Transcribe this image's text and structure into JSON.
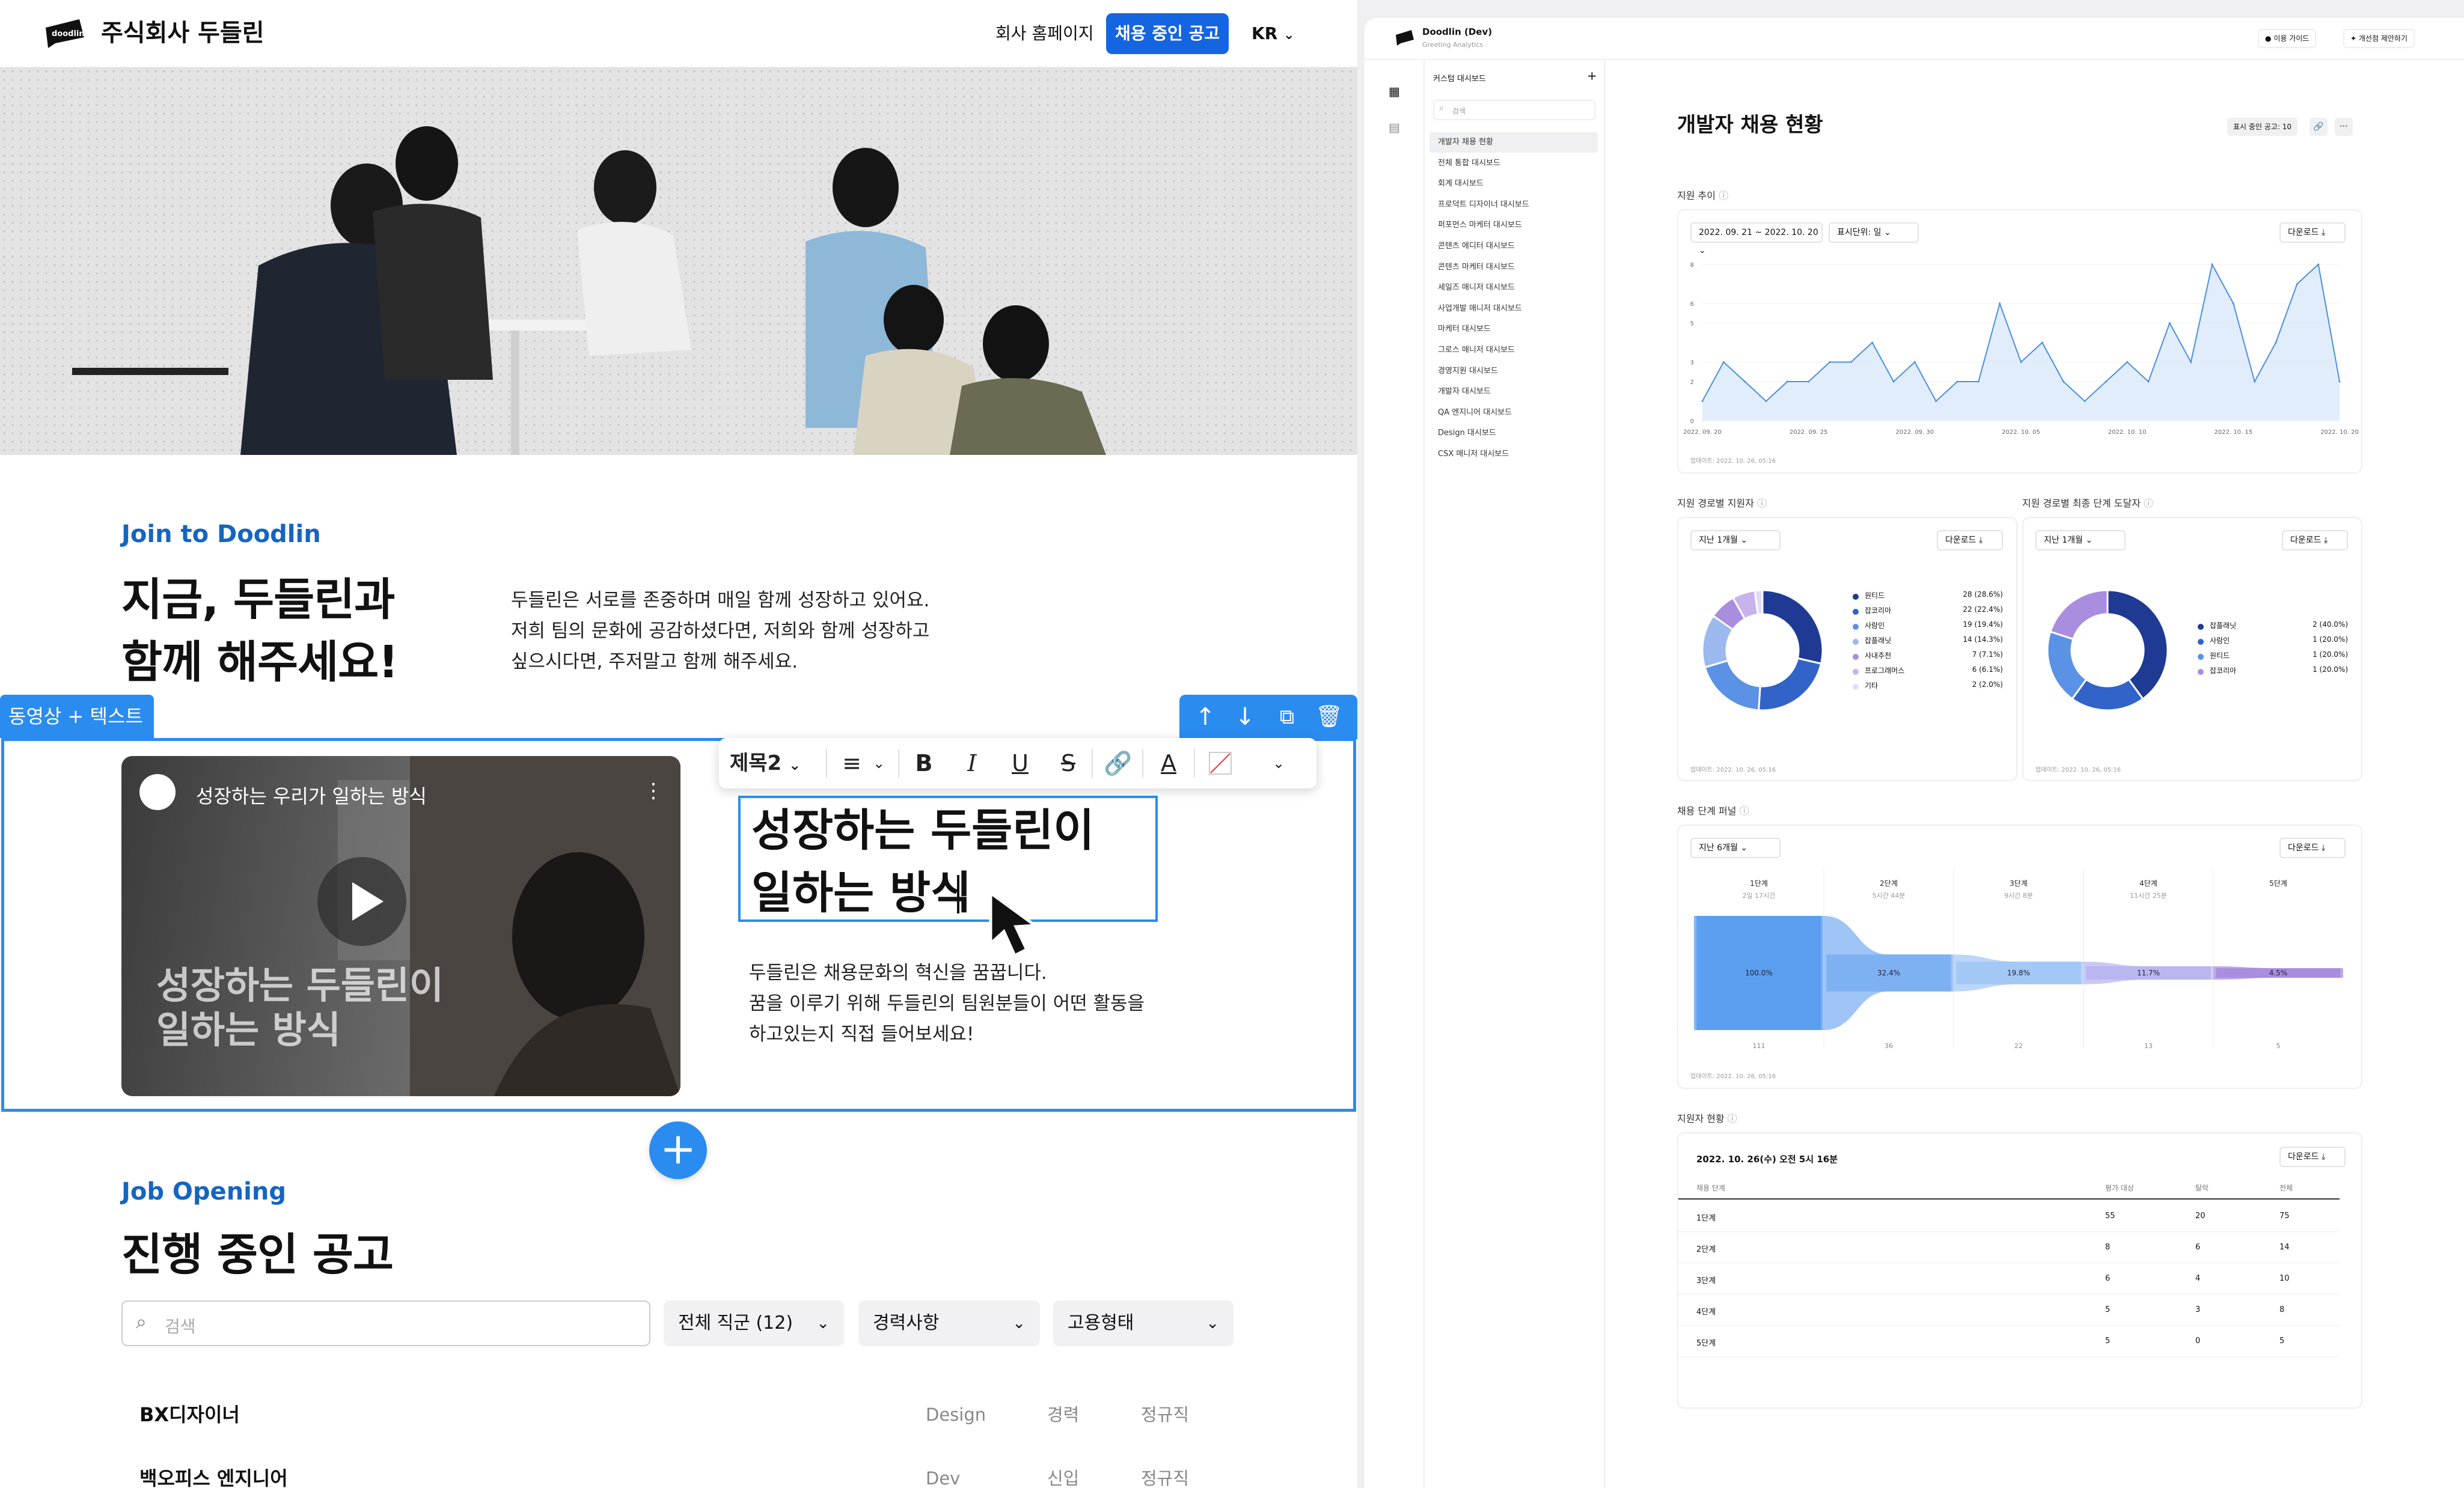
{
  "left": {
    "header": {
      "company": "주식회사 두들린",
      "logo_text": "doodlin",
      "nav_home": "회사 홈페이지",
      "nav_jobs": "채용 중인 공고",
      "lang": "KR"
    },
    "intro": {
      "eyebrow": "Join to Doodlin",
      "headline_1": "지금, 두들린과",
      "headline_2": "함께 해주세요!",
      "body_1": "두들린은 서로를 존중하며 매일 함께 성장하고 있어요.",
      "body_2": "저희 팀의 문화에 공감하셨다면, 저희와 함께 성장하고",
      "body_3": "싶으시다면, 주저말고 함께 해주세요."
    },
    "editor": {
      "block_tag": "동영상 + 텍스트",
      "video_title": "성장하는 우리가 일하는 방식",
      "video_overlay_1": "성장하는 두들린이",
      "video_overlay_2": "일하는 방식",
      "format_style": "제목2",
      "heading_1": "성장하는 두들린이",
      "heading_2": "일하는 방식",
      "body_1": "두들린은 채용문화의 혁신을 꿈꿉니다.",
      "body_2": "꿈을 이루기 위해 두들린의 팀원분들이 어떤 활동을",
      "body_3": "하고있는지 직접 들어보세요!"
    },
    "jobs": {
      "eyebrow": "Job Opening",
      "title": "진행 중인 공고",
      "search_placeholder": "검색",
      "filters": [
        "전체 직군 (12)",
        "경력사항",
        "고용형태"
      ],
      "rows": [
        {
          "title": "BX디자이너",
          "dept": "Design",
          "career": "경력",
          "type": "정규직"
        },
        {
          "title": "백오피스 엔지니어",
          "dept": "Dev",
          "career": "신입",
          "type": "정규직"
        }
      ]
    }
  },
  "dashboard": {
    "app_title": "Doodlin (Dev)",
    "app_subtitle": "Greeting Analytics",
    "header_buttons": [
      "이용 가이드",
      "개선점 제안하기"
    ],
    "custom_dash": "커스텀 대시보드",
    "search_placeholder": "검색",
    "menu": [
      "개발자 채용 현황",
      "전체 통합 대시보드",
      "회계 대시보드",
      "프로덕트 디자이너 대시보드",
      "퍼포먼스 마케터 대시보드",
      "콘텐츠 에디터 대시보드",
      "콘텐츠 마케터 대시보드",
      "세일즈 매니저 대시보드",
      "사업개발 매니저 대시보드",
      "마케터 대시보드",
      "그로스 매니저 대시보드",
      "경영지원 대시보드",
      "개발자 대시보드",
      "QA 엔지니어 대시보드",
      "Design 대시보드",
      "CSX 매니저 대시보드"
    ],
    "page_title": "개발자 채용 현황",
    "open_jobs_badge": "표시 중인 공고: 10",
    "trend": {
      "label": "지원 추이",
      "date_range": "2022. 09. 21 ~ 2022. 10. 20",
      "unit": "표시단위: 일",
      "download": "다운로드",
      "updated": "업데이트: 2022. 10. 26, 05:16"
    },
    "source": {
      "label": "지원 경로별 지원자",
      "period": "지난 1개월",
      "download": "다운로드",
      "updated": "업데이트: 2022. 10. 26, 05:16",
      "legend": [
        {
          "name": "원티드",
          "value": "28 (28.6%)",
          "color": "#1f3a93"
        },
        {
          "name": "잡코리아",
          "value": "22 (22.4%)",
          "color": "#3163c9"
        },
        {
          "name": "사람인",
          "value": "19 (19.4%)",
          "color": "#5b92e5"
        },
        {
          "name": "잡플래닛",
          "value": "14 (14.3%)",
          "color": "#9bb8ef"
        },
        {
          "name": "사내추천",
          "value": "7 (7.1%)",
          "color": "#a98ddf"
        },
        {
          "name": "프로그래머스",
          "value": "6 (6.1%)",
          "color": "#c7b3ee"
        },
        {
          "name": "기타",
          "value": "2 (2.0%)",
          "color": "#e4dbf7"
        }
      ]
    },
    "final": {
      "label": "지원 경로별 최종 단계 도달자",
      "period": "지난 1개월",
      "download": "다운로드",
      "updated": "업데이트: 2022. 10. 26, 05:16",
      "legend": [
        {
          "name": "잡플래닛",
          "value": "2 (40.0%)",
          "color": "#1f3a93"
        },
        {
          "name": "사람인",
          "value": "1 (20.0%)",
          "color": "#3163c9"
        },
        {
          "name": "원티드",
          "value": "1 (20.0%)",
          "color": "#5b92e5"
        },
        {
          "name": "잡코리아",
          "value": "1 (20.0%)",
          "color": "#a98ddf"
        }
      ]
    },
    "funnel": {
      "label": "채용 단계 퍼널",
      "period": "지난 6개월",
      "download": "다운로드",
      "updated": "업데이트: 2022. 10. 26, 05:16",
      "stages": [
        "1단계",
        "2단계",
        "3단계",
        "4단계",
        "5단계"
      ],
      "durations": [
        "2일 17시간",
        "5시간 44분",
        "9시간 8분",
        "11시간 25분",
        ""
      ],
      "percents": [
        "100.0%",
        "32.4%",
        "19.8%",
        "11.7%",
        "4.5%"
      ],
      "counts": [
        "111",
        "36",
        "22",
        "13",
        "5"
      ],
      "colors": [
        "#5b9ff0",
        "#7eb1f2",
        "#a3c8f6",
        "#b9b6f0",
        "#a98ddf"
      ]
    },
    "applicants": {
      "label": "지원자 현황",
      "timestamp": "2022. 10. 26(수) 오전 5시 16분",
      "download": "다운로드",
      "headers": [
        "채용 단계",
        "평가 대상",
        "탈락",
        "전체"
      ],
      "rows": [
        [
          "1단계",
          "55",
          "20",
          "75"
        ],
        [
          "2단계",
          "8",
          "6",
          "14"
        ],
        [
          "3단계",
          "6",
          "4",
          "10"
        ],
        [
          "4단계",
          "5",
          "3",
          "8"
        ],
        [
          "5단계",
          "5",
          "0",
          "5"
        ]
      ]
    }
  },
  "chart_data": {
    "type": "line",
    "x": [
      "2022.09.20",
      "2022.09.21",
      "2022.09.22",
      "2022.09.23",
      "2022.09.24",
      "2022.09.25",
      "2022.09.26",
      "2022.09.27",
      "2022.09.28",
      "2022.09.29",
      "2022.09.30",
      "2022.10.01",
      "2022.10.02",
      "2022.10.03",
      "2022.10.04",
      "2022.10.05",
      "2022.10.06",
      "2022.10.07",
      "2022.10.08",
      "2022.10.09",
      "2022.10.10",
      "2022.10.11",
      "2022.10.12",
      "2022.10.13",
      "2022.10.14",
      "2022.10.15",
      "2022.10.16",
      "2022.10.17",
      "2022.10.18",
      "2022.10.19",
      "2022.10.20"
    ],
    "values": [
      1,
      3,
      2,
      1,
      2,
      2,
      3,
      3,
      4,
      2,
      3,
      1,
      2,
      2,
      6,
      3,
      4,
      2,
      1,
      2,
      3,
      2,
      5,
      3,
      8,
      6,
      2,
      4,
      7,
      8,
      2
    ],
    "xticks": [
      "2022. 09. 20",
      "2022. 09. 25",
      "2022. 09. 30",
      "2022. 10. 05",
      "2022. 10. 10",
      "2022. 10. 15",
      "2022. 10. 20"
    ],
    "yticks": [
      "0",
      "2",
      "3",
      "5",
      "6",
      "8"
    ],
    "ylim": [
      0,
      8
    ],
    "title": "지원 추이",
    "xlabel": "",
    "ylabel": ""
  }
}
